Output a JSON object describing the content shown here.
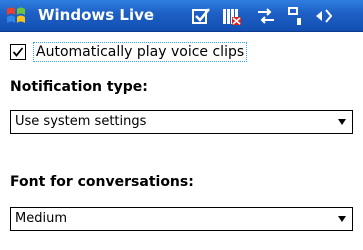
{
  "titlebar": {
    "title": "Windows Live",
    "icons": [
      "start-flag-icon",
      "checkbox-status-icon",
      "no-signal-icon",
      "sync-arrows-icon",
      "phone-icon",
      "speaker-icon"
    ]
  },
  "settings": {
    "auto_play": {
      "label": "Automatically play voice clips",
      "checked": true
    },
    "notification": {
      "label": "Notification type:",
      "value": "Use system settings"
    },
    "font": {
      "label": "Font for conversations:",
      "value": "Medium"
    }
  },
  "colors": {
    "titlebar_top": "#2f7de0",
    "titlebar_bottom": "#134fb3",
    "focus_border": "#3aa7e0"
  }
}
